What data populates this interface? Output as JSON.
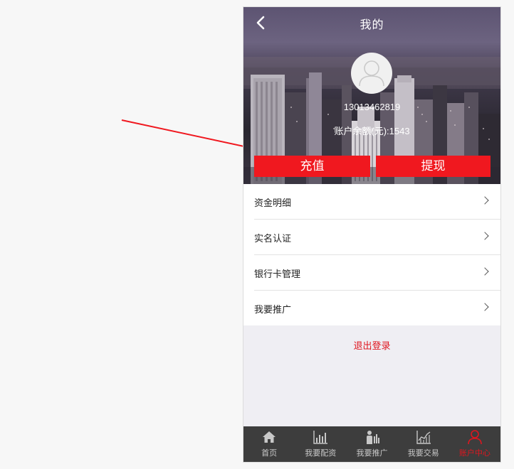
{
  "header": {
    "title": "我的",
    "back_icon": "chevron-left-icon"
  },
  "profile": {
    "avatar_icon": "user-icon",
    "phone": "13013462819",
    "balance": "账户余额(元):1543"
  },
  "actions": {
    "recharge_label": "充值",
    "withdraw_label": "提现",
    "accent_color": "#f0181f"
  },
  "menu": {
    "items": [
      {
        "label": "资金明细",
        "icon": "chevron-right-icon"
      },
      {
        "label": "实名认证",
        "icon": "chevron-right-icon"
      },
      {
        "label": "银行卡管理",
        "icon": "chevron-right-icon"
      },
      {
        "label": "我要推广",
        "icon": "chevron-right-icon"
      }
    ]
  },
  "logout_label": "退出登录",
  "tabbar": {
    "active_color": "#e0161f",
    "tabs": [
      {
        "label": "首页",
        "icon": "home-icon",
        "active": false
      },
      {
        "label": "我要配资",
        "icon": "bar-chart-icon",
        "active": false
      },
      {
        "label": "我要推广",
        "icon": "presenter-icon",
        "active": false
      },
      {
        "label": "我要交易",
        "icon": "line-chart-icon",
        "active": false
      },
      {
        "label": "账户中心",
        "icon": "user-icon",
        "active": true
      }
    ]
  },
  "annotation": {
    "type": "red-arrow",
    "points_to": "recharge-button",
    "color": "#f0181f"
  }
}
